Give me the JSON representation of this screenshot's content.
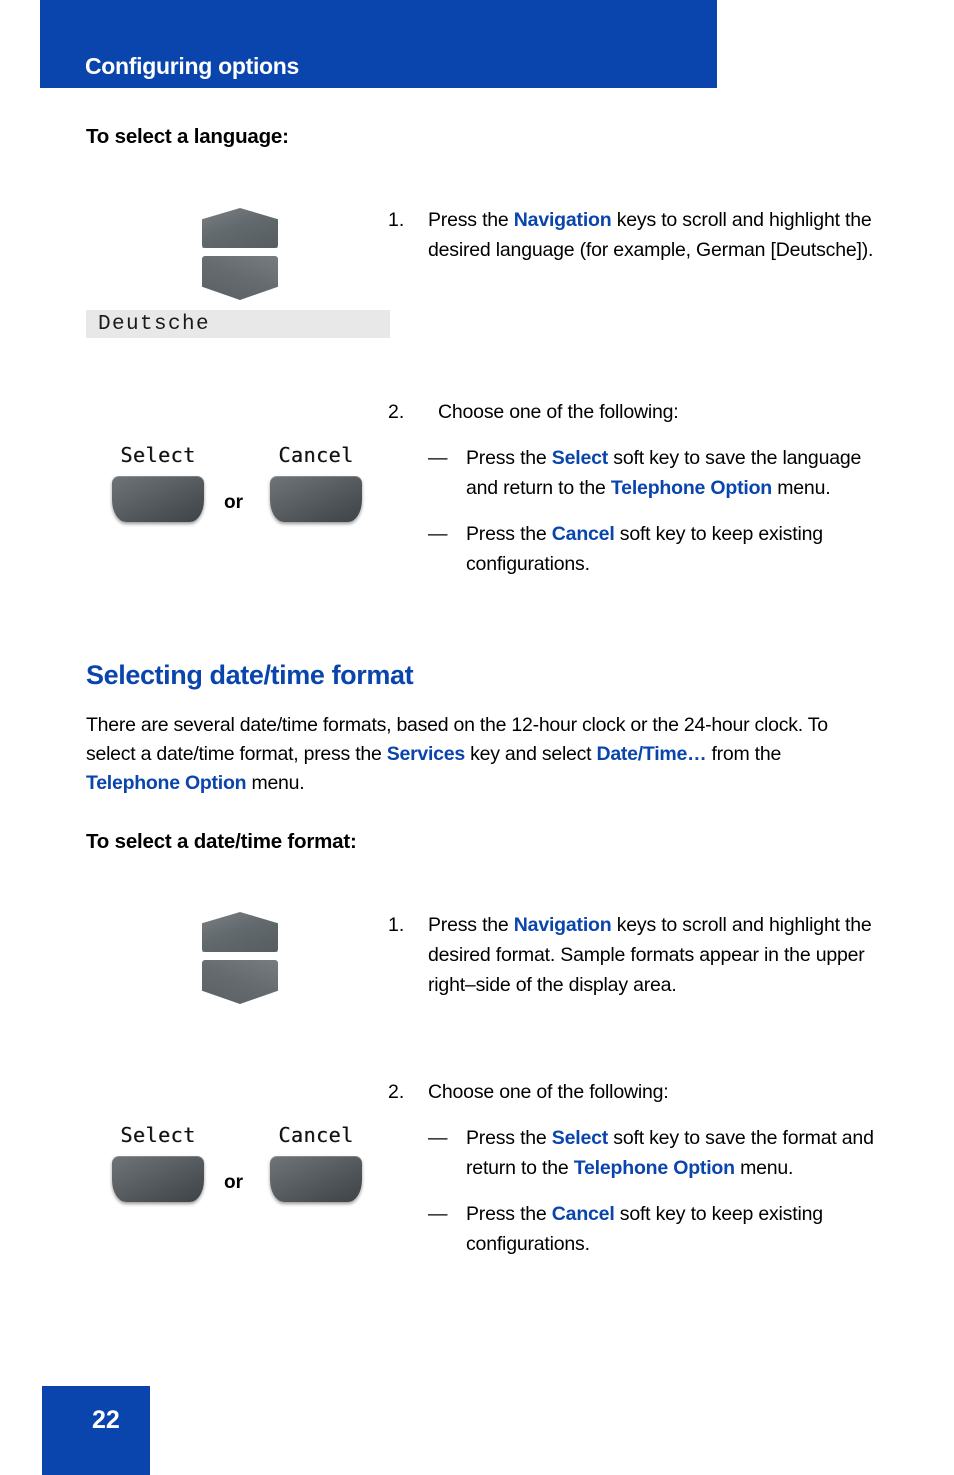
{
  "header": {
    "title": "Configuring options",
    "banner_color": "#0a45ad"
  },
  "language_section": {
    "heading": "To select a language:",
    "nav_key_icon": "navigation-keys-icon",
    "lcd_value": "Deutsche",
    "step1": {
      "number": "1.",
      "text_before": "Press the ",
      "bold_term": "Navigation",
      "text_after": " keys to scroll and highlight the desired language (for example, German [Deutsche])."
    },
    "step2": {
      "number": "2.",
      "lead": "Choose one of the following:",
      "bullets": [
        {
          "mark": "—",
          "p1": "Press the ",
          "b1": "Select",
          "p2": " soft key to save the language and return to the ",
          "b2": "Telephone Option",
          "p3": " menu."
        },
        {
          "mark": "—",
          "p1": "Press the ",
          "b1": "Cancel",
          "p2": " soft key to keep existing configurations.",
          "b2": "",
          "p3": ""
        }
      ]
    },
    "softkeys": {
      "select_label": "Select",
      "or_label": "or",
      "cancel_label": "Cancel"
    }
  },
  "datetime_section": {
    "section_heading": "Selecting date/time format",
    "paragraph": {
      "p1": "There are several date/time formats, based on the 12-hour clock or the 24-hour clock. To select a date/time format, press the ",
      "b1": "Services",
      "p2": " key and select ",
      "b2": "Date/Time…",
      "p3": " from the ",
      "b3": "Telephone Option",
      "p4": " menu."
    },
    "heading": "To select a date/time format:",
    "nav_key_icon": "navigation-keys-icon",
    "step1": {
      "number": "1.",
      "text_before": "Press the ",
      "bold_term": "Navigation",
      "text_after": " keys to scroll and highlight the desired format. Sample formats appear in the upper right–side of the display area."
    },
    "step2": {
      "number": "2.",
      "lead": "Choose one of the following:",
      "bullets": [
        {
          "mark": "—",
          "p1": "Press the ",
          "b1": "Select",
          "p2": " soft key to save the format and return to the ",
          "b2": "Telephone Option",
          "p3": " menu."
        },
        {
          "mark": "—",
          "p1": "Press the ",
          "b1": "Cancel",
          "p2": " soft key to keep existing configurations.",
          "b2": "",
          "p3": ""
        }
      ]
    },
    "softkeys": {
      "select_label": "Select",
      "or_label": "or",
      "cancel_label": "Cancel"
    }
  },
  "footer": {
    "page_number": "22"
  }
}
